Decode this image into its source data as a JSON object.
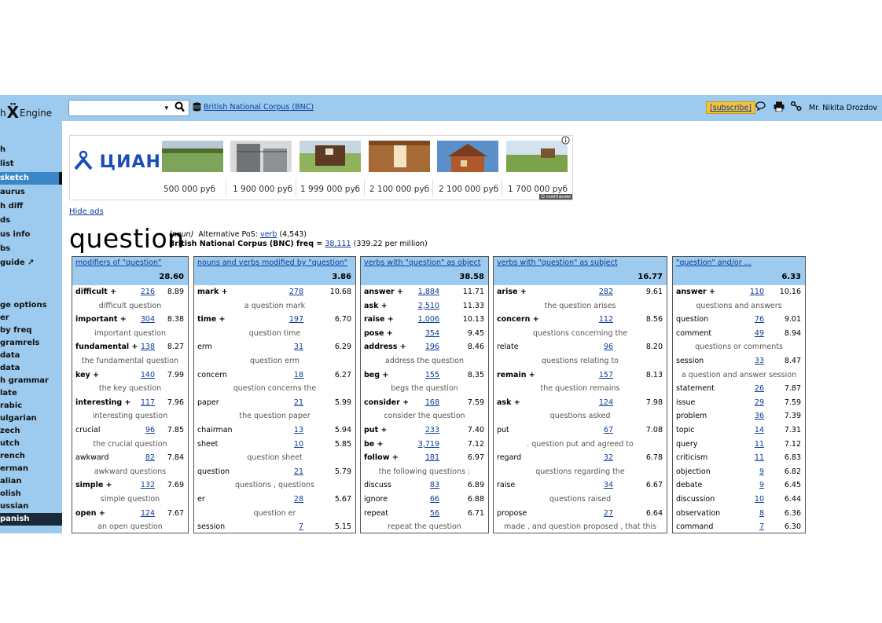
{
  "topbar": {
    "logo_left": "h",
    "logo_mark": "Ẍ",
    "logo_right": "Engine",
    "search_dropdown": "▾",
    "search_icon": "search-icon",
    "corpus_link": "British National Corpus (BNC)",
    "subscribe": "[subscribe]",
    "icons": [
      "chat-icon",
      "print-icon",
      "share-icon"
    ],
    "user": "Mr. Nikita Drozdov"
  },
  "sidebar": {
    "items": [
      {
        "label": "h"
      },
      {
        "label": " list"
      },
      {
        "label": " sketch"
      },
      {
        "label": "aurus"
      },
      {
        "label": "h diff"
      },
      {
        "label": "ds"
      },
      {
        "label": "us info"
      },
      {
        "label": "bs"
      },
      {
        "label": "guide ↗"
      },
      {
        "label": "ge options"
      },
      {
        "label": "er"
      },
      {
        "label": "by freq"
      },
      {
        "label": "gramrels"
      },
      {
        "label": "data"
      },
      {
        "label": "data"
      },
      {
        "label": "h grammar"
      },
      {
        "label": "late"
      },
      {
        "label": "rabic"
      },
      {
        "label": "ulgarian"
      },
      {
        "label": "zech"
      },
      {
        "label": "utch"
      },
      {
        "label": "rench"
      },
      {
        "label": "erman"
      },
      {
        "label": "alian"
      },
      {
        "label": "olish"
      },
      {
        "label": "ussian"
      },
      {
        "label": "panish"
      }
    ]
  },
  "ad": {
    "brand": "ЦИАН",
    "prices": [
      "500 000 руб",
      "1 900 000 руб",
      "1 999 000 руб",
      "2 100 000 руб",
      "2 100 000 руб",
      "1 700 000 руб"
    ],
    "company_label": "О компании",
    "info_icon": "info-icon",
    "hide": "Hide ads"
  },
  "headword": {
    "word": "question",
    "pos_prefix": "(noun)",
    "alt_label": "Alternative PoS:",
    "alt_link": "verb",
    "alt_count": "(4,543)",
    "freq_label": "British National Corpus (BNC) freq =",
    "freq_link": "38,111",
    "freq_per_million": "(339.22 per million)"
  },
  "columns": [
    {
      "title": "modifiers of \"question\"",
      "score": "28.60",
      "rows": [
        {
          "word": "difficult +",
          "bold": true,
          "count": "216",
          "score": "8.89"
        },
        {
          "example": "difficult question"
        },
        {
          "word": "important +",
          "bold": true,
          "count": "304",
          "score": "8.38"
        },
        {
          "example": "important question"
        },
        {
          "word": "fundamental +",
          "bold": true,
          "count": "138",
          "score": "8.27"
        },
        {
          "example": "the fundamental question"
        },
        {
          "word": "key +",
          "bold": true,
          "count": "140",
          "score": "7.99"
        },
        {
          "example": "the key question"
        },
        {
          "word": "interesting +",
          "bold": true,
          "count": "117",
          "score": "7.96"
        },
        {
          "example": "interesting question"
        },
        {
          "word": "crucial",
          "bold": false,
          "count": "96",
          "score": "7.85"
        },
        {
          "example": "the crucial question"
        },
        {
          "word": "awkward",
          "bold": false,
          "count": "82",
          "score": "7.84"
        },
        {
          "example": "awkward questions"
        },
        {
          "word": "simple +",
          "bold": true,
          "count": "132",
          "score": "7.69"
        },
        {
          "example": "simple question"
        },
        {
          "word": "open +",
          "bold": true,
          "count": "124",
          "score": "7.67"
        },
        {
          "example": "an open question"
        }
      ]
    },
    {
      "title": "nouns and verbs modified by \"question\"",
      "score": "3.86",
      "rows": [
        {
          "word": "mark +",
          "bold": true,
          "count": "278",
          "score": "10.68"
        },
        {
          "example": "a question mark"
        },
        {
          "word": "time +",
          "bold": true,
          "count": "197",
          "score": "6.70"
        },
        {
          "example": "question time"
        },
        {
          "word": "erm",
          "bold": false,
          "count": "31",
          "score": "6.29"
        },
        {
          "example": "question erm"
        },
        {
          "word": "concern",
          "bold": false,
          "count": "18",
          "score": "6.27"
        },
        {
          "example": "question concerns the"
        },
        {
          "word": "paper",
          "bold": false,
          "count": "21",
          "score": "5.99"
        },
        {
          "example": "the question paper"
        },
        {
          "word": "chairman",
          "bold": false,
          "count": "13",
          "score": "5.94"
        },
        {
          "word": "sheet",
          "bold": false,
          "count": "10",
          "score": "5.85"
        },
        {
          "example": "question sheet"
        },
        {
          "word": "question",
          "bold": false,
          "count": "21",
          "score": "5.79"
        },
        {
          "example": "questions , questions"
        },
        {
          "word": "er",
          "bold": false,
          "count": "28",
          "score": "5.67"
        },
        {
          "example": "question er"
        },
        {
          "word": "session",
          "bold": false,
          "count": "7",
          "score": "5.15"
        }
      ]
    },
    {
      "title": "verbs with \"question\" as object",
      "score": "38.58",
      "rows": [
        {
          "word": "answer +",
          "bold": true,
          "count": "1,884",
          "score": "11.71"
        },
        {
          "word": "ask +",
          "bold": true,
          "count": "2,510",
          "score": "11.33"
        },
        {
          "word": "raise +",
          "bold": true,
          "count": "1,006",
          "score": "10.13"
        },
        {
          "word": "pose +",
          "bold": true,
          "count": "354",
          "score": "9.45"
        },
        {
          "word": "address +",
          "bold": true,
          "count": "196",
          "score": "8.46"
        },
        {
          "example": "address the question"
        },
        {
          "word": "beg +",
          "bold": true,
          "count": "155",
          "score": "8.35"
        },
        {
          "example": "begs the question"
        },
        {
          "word": "consider +",
          "bold": true,
          "count": "168",
          "score": "7.59"
        },
        {
          "example": "consider the question"
        },
        {
          "word": "put +",
          "bold": true,
          "count": "233",
          "score": "7.40"
        },
        {
          "word": "be +",
          "bold": true,
          "count": "3,719",
          "score": "7.12"
        },
        {
          "word": "follow +",
          "bold": true,
          "count": "181",
          "score": "6.97"
        },
        {
          "example": "the following questions :"
        },
        {
          "word": "discuss",
          "bold": false,
          "count": "83",
          "score": "6.89"
        },
        {
          "word": "ignore",
          "bold": false,
          "count": "66",
          "score": "6.88"
        },
        {
          "word": "repeat",
          "bold": false,
          "count": "56",
          "score": "6.71"
        },
        {
          "example": "repeat the question"
        }
      ]
    },
    {
      "title": "verbs with \"question\" as subject",
      "score": "16.77",
      "rows": [
        {
          "word": "arise +",
          "bold": true,
          "count": "282",
          "score": "9.61"
        },
        {
          "example": "the question arises"
        },
        {
          "word": "concern +",
          "bold": true,
          "count": "112",
          "score": "8.56"
        },
        {
          "example": "questions concerning the"
        },
        {
          "word": "relate",
          "bold": false,
          "count": "96",
          "score": "8.20"
        },
        {
          "example": "questions relating to"
        },
        {
          "word": "remain +",
          "bold": true,
          "count": "157",
          "score": "8.13"
        },
        {
          "example": "the question remains"
        },
        {
          "word": "ask +",
          "bold": true,
          "count": "124",
          "score": "7.98"
        },
        {
          "example": "questions asked"
        },
        {
          "word": "put",
          "bold": false,
          "count": "67",
          "score": "7.08"
        },
        {
          "example": ". question put and agreed to"
        },
        {
          "word": "regard",
          "bold": false,
          "count": "32",
          "score": "6.78"
        },
        {
          "example": "questions regarding the"
        },
        {
          "word": "raise",
          "bold": false,
          "count": "34",
          "score": "6.67"
        },
        {
          "example": "questions raised"
        },
        {
          "word": "propose",
          "bold": false,
          "count": "27",
          "score": "6.64"
        },
        {
          "example": "made , and question proposed , that this"
        }
      ]
    },
    {
      "title": "\"question\" and/or ...",
      "score": "6.33",
      "rows": [
        {
          "word": "answer +",
          "bold": true,
          "count": "110",
          "score": "10.16"
        },
        {
          "example": "questions and answers"
        },
        {
          "word": "question",
          "bold": false,
          "count": "76",
          "score": "9.01"
        },
        {
          "word": "comment",
          "bold": false,
          "count": "49",
          "score": "8.94"
        },
        {
          "example": "questions or comments"
        },
        {
          "word": "session",
          "bold": false,
          "count": "33",
          "score": "8.47"
        },
        {
          "example": "a question and answer session"
        },
        {
          "word": "statement",
          "bold": false,
          "count": "26",
          "score": "7.87"
        },
        {
          "word": "issue",
          "bold": false,
          "count": "29",
          "score": "7.59"
        },
        {
          "word": "problem",
          "bold": false,
          "count": "36",
          "score": "7.39"
        },
        {
          "word": "topic",
          "bold": false,
          "count": "14",
          "score": "7.31"
        },
        {
          "word": "query",
          "bold": false,
          "count": "11",
          "score": "7.12"
        },
        {
          "word": "criticism",
          "bold": false,
          "count": "11",
          "score": "6.83"
        },
        {
          "word": "objection",
          "bold": false,
          "count": "9",
          "score": "6.82"
        },
        {
          "word": "debate",
          "bold": false,
          "count": "9",
          "score": "6.45"
        },
        {
          "word": "discussion",
          "bold": false,
          "count": "10",
          "score": "6.44"
        },
        {
          "word": "observation",
          "bold": false,
          "count": "8",
          "score": "6.36"
        },
        {
          "word": "command",
          "bold": false,
          "count": "7",
          "score": "6.30"
        }
      ]
    }
  ]
}
